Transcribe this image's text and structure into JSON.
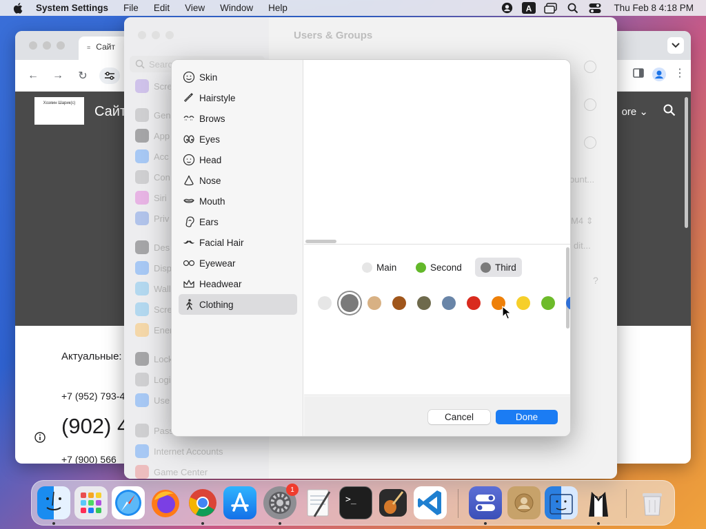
{
  "menubar": {
    "app_name": "System Settings",
    "menus": [
      "File",
      "Edit",
      "View",
      "Window",
      "Help"
    ],
    "clock": "Thu Feb 8  4:18 PM"
  },
  "browser": {
    "tab_title": "Сайт",
    "logo_text": "Хозяин Шарик(с)",
    "site_title": "Сайт",
    "more_label": "ore",
    "actual_label": "Актуальные:",
    "phone1": "+7 (952) 793-4",
    "phone2": "(902) 4",
    "phone3": "+7 (900) 566"
  },
  "settings": {
    "window_title": "Users & Groups",
    "search_placeholder": "Search",
    "sidebar_items": [
      {
        "label": "Scre",
        "color": "#8e6bd8"
      },
      {
        "label": "Gen",
        "color": "#8e8e93"
      },
      {
        "label": "App",
        "color": "#1c1c1e"
      },
      {
        "label": "Acc",
        "color": "#1f7cf5"
      },
      {
        "label": "Con",
        "color": "#8e8e93"
      },
      {
        "label": "Siri",
        "color": "#d246c8"
      },
      {
        "label": "Priv",
        "color": "#3a6fd8"
      },
      {
        "label": "Des",
        "color": "#1c1c1e"
      },
      {
        "label": "Disp",
        "color": "#1f7cf5"
      },
      {
        "label": "Wall",
        "color": "#3fa8e6"
      },
      {
        "label": "Scre",
        "color": "#3fa8e6"
      },
      {
        "label": "Ener",
        "color": "#f5a623"
      },
      {
        "label": "Lock",
        "color": "#1c1c1e"
      },
      {
        "label": "Logi",
        "color": "#8e8e93"
      },
      {
        "label": "Use",
        "color": "#1f7cf5"
      },
      {
        "label": "Pass",
        "color": "#8e8e93"
      },
      {
        "label": "Internet Accounts",
        "color": "#1f7cf5"
      },
      {
        "label": "Game Center",
        "color": "#e25c5c"
      }
    ],
    "ghost_account": "ount...",
    "ghost_m4": "M4",
    "ghost_edit": "dit..."
  },
  "sheet": {
    "categories": [
      {
        "label": "Skin",
        "icon": "smiley-icon"
      },
      {
        "label": "Hairstyle",
        "icon": "comb-icon"
      },
      {
        "label": "Brows",
        "icon": "brows-icon"
      },
      {
        "label": "Eyes",
        "icon": "eyes-icon"
      },
      {
        "label": "Head",
        "icon": "head-icon"
      },
      {
        "label": "Nose",
        "icon": "nose-icon"
      },
      {
        "label": "Mouth",
        "icon": "mouth-icon"
      },
      {
        "label": "Ears",
        "icon": "ear-icon"
      },
      {
        "label": "Facial Hair",
        "icon": "mustache-icon"
      },
      {
        "label": "Eyewear",
        "icon": "glasses-icon"
      },
      {
        "label": "Headwear",
        "icon": "crown-icon"
      },
      {
        "label": "Clothing",
        "icon": "figure-icon",
        "selected": true
      }
    ],
    "color_slots": [
      {
        "label": "Main",
        "color": "#e6e6e6"
      },
      {
        "label": "Second",
        "color": "#63b82a"
      },
      {
        "label": "Third",
        "color": "#7a7a7a",
        "selected": true
      }
    ],
    "swatches": [
      "#e6e6e6",
      "#7a7a7a",
      "#d8b184",
      "#a0561b",
      "#6e6a4c",
      "#6985a8",
      "#d92b1e",
      "#ee8009",
      "#f6cf2a",
      "#6dbb2a",
      "#2e6fd6"
    ],
    "selected_swatch": 1,
    "cancel_label": "Cancel",
    "done_label": "Done",
    "accent": "#1b7cf3"
  },
  "dock": {
    "apps": [
      "Finder",
      "Launchpad",
      "Safari",
      "Firefox",
      "Chrome",
      "App Store",
      "System Settings",
      "TextEdit",
      "Terminal",
      "GarageBand",
      "Visual Studio Code",
      "Control Center",
      "Contacts",
      "Finder Alt",
      "Bartender",
      "Trash"
    ],
    "settings_badge": "1"
  }
}
